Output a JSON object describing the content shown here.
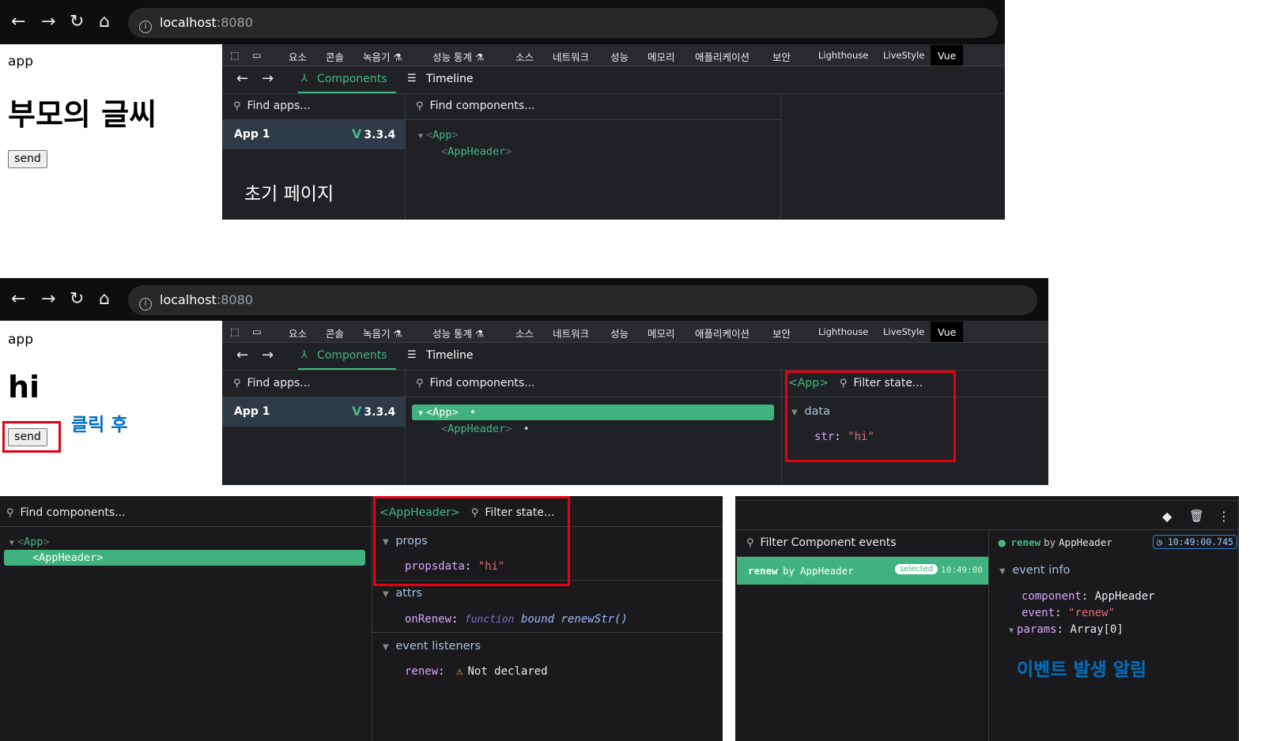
{
  "browser": {
    "url_host": "localhost",
    "url_port": ":8080",
    "back_icon": "←",
    "forward_icon": "→",
    "reload_icon": "↻",
    "home_icon": "⌂",
    "info_icon": "i"
  },
  "page_before": {
    "app_label": "app",
    "heading": "부모의 글씨",
    "send_label": "send"
  },
  "page_after": {
    "app_label": "app",
    "heading": "hi",
    "send_label": "send"
  },
  "devtools_tabs": [
    "요소",
    "콘솔",
    "녹음기 ⚗",
    "성능 통계 ⚗",
    "소스",
    "네트워크",
    "성능",
    "메모리",
    "애플리케이션",
    "보안",
    "Lighthouse",
    "LiveStyle",
    "Vue"
  ],
  "vue": {
    "components_tab": "Components",
    "timeline_tab": "Timeline",
    "find_apps": "Find apps...",
    "find_components": "Find components...",
    "app_name": "App 1",
    "vue_logo": "V",
    "vue_version": "3.3.4",
    "tree_app": "App",
    "tree_child": "AppHeader",
    "tree_dot": "•",
    "lt": "<",
    "gt": ">",
    "filter_state": "Filter state...",
    "app_selected_tag": "<App>",
    "appheader_selected_tag": "<AppHeader>",
    "data_section": "data",
    "data_key": "str",
    "data_value": "\"hi\"",
    "props_section": "props",
    "props_key": "propsdata",
    "props_value": "\"hi\"",
    "attrs_section": "attrs",
    "attrs_key": "onRenew",
    "attrs_fn_kw": "function",
    "attrs_fn_bound": "bound",
    "attrs_fn_name": "renewStr()",
    "listeners_section": "event listeners",
    "listener_key": "renew",
    "warn_icon": "⚠",
    "listener_value": "Not declared",
    "colon": ":"
  },
  "timeline": {
    "filter_events": "Filter Component events",
    "event_name": "renew",
    "by": "by",
    "event_source": "AppHeader",
    "selected_badge": "selected",
    "event_time_short": "10:49:00",
    "event_time_full": "10:49:00.745",
    "event_info": "event info",
    "component_key": "component",
    "component_val": "AppHeader",
    "event_key": "event",
    "event_val": "\"renew\"",
    "params_key": "params",
    "params_val": "Array[0]"
  },
  "annotations": {
    "initial_page": "초기 페이지",
    "after_click": "클릭 후",
    "event_notice": "이벤트 발생 알림"
  }
}
